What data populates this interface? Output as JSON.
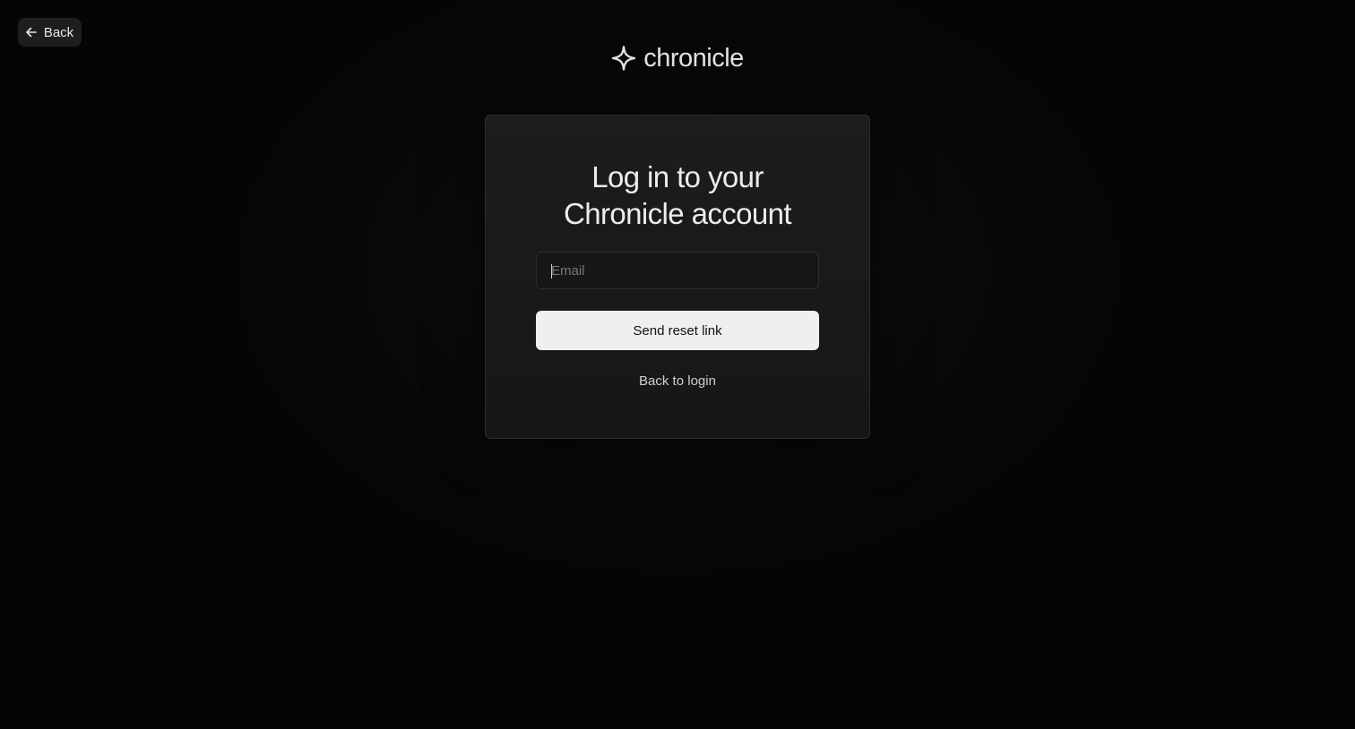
{
  "header": {
    "back_label": "Back",
    "back_icon": "arrow-left-icon"
  },
  "logo": {
    "icon": "sparkle-icon",
    "brand": "chronicle"
  },
  "card": {
    "title_line1": "Log in to your",
    "title_line2": "Chronicle account",
    "email": {
      "placeholder": "Email",
      "value": ""
    },
    "send_label": "Send reset link",
    "back_to_login_label": "Back to login"
  },
  "colors": {
    "background": "#060606",
    "card": "#1b1b1b",
    "button": "#efefef",
    "text": "#e6e6e6"
  }
}
